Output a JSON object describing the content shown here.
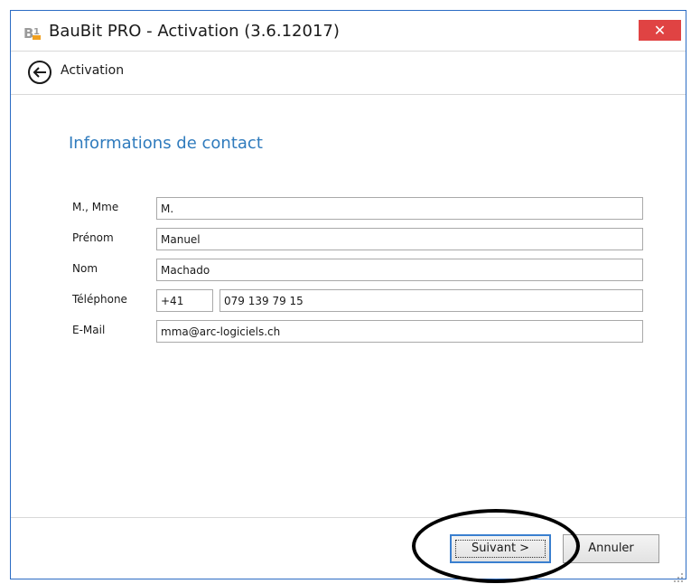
{
  "window": {
    "title": "BauBit PRO - Activation (3.6.12017)",
    "close_label": "✕"
  },
  "nav": {
    "label": "Activation"
  },
  "section": {
    "title": "Informations de contact"
  },
  "form": {
    "salutation": {
      "label": "M., Mme",
      "value": "M."
    },
    "first_name": {
      "label": "Prénom",
      "value": "Manuel"
    },
    "last_name": {
      "label": "Nom",
      "value": "Machado"
    },
    "phone": {
      "label": "Téléphone",
      "prefix": "+41",
      "number": "079 139 79 15"
    },
    "email": {
      "label": "E-Mail",
      "value": "mma@arc-logiciels.ch"
    }
  },
  "buttons": {
    "next": "Suivant >",
    "cancel": "Annuler"
  },
  "colors": {
    "accent": "#2f7bbd",
    "close": "#e04343",
    "border": "#2b6cc4"
  }
}
